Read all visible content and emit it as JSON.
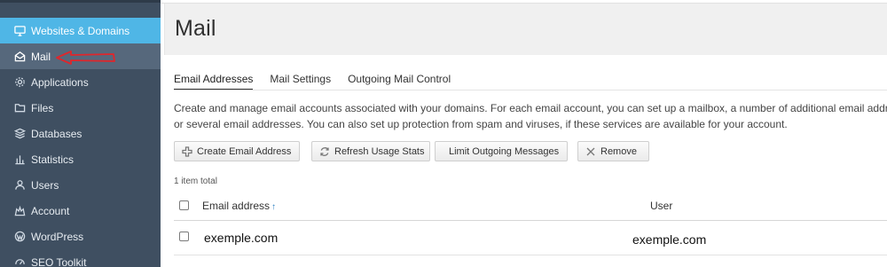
{
  "sidebar": {
    "items": [
      {
        "label": "Websites & Domains",
        "icon": "monitor-icon"
      },
      {
        "label": "Mail",
        "icon": "envelope-icon"
      },
      {
        "label": "Applications",
        "icon": "gear-icon"
      },
      {
        "label": "Files",
        "icon": "folder-icon"
      },
      {
        "label": "Databases",
        "icon": "database-icon"
      },
      {
        "label": "Statistics",
        "icon": "bar-chart-icon"
      },
      {
        "label": "Users",
        "icon": "user-icon"
      },
      {
        "label": "Account",
        "icon": "account-icon"
      },
      {
        "label": "WordPress",
        "icon": "wordpress-icon"
      },
      {
        "label": "SEO Toolkit",
        "icon": "seo-icon"
      }
    ],
    "annotation_color": "#e0262b"
  },
  "header": {
    "title": "Mail"
  },
  "tabs": [
    {
      "label": "Email Addresses",
      "active": true
    },
    {
      "label": "Mail Settings",
      "active": false
    },
    {
      "label": "Outgoing Mail Control",
      "active": false
    }
  ],
  "description": {
    "line1": "Create and manage email accounts associated with your domains. For each email account, you can set up a mailbox, a number of additional email addres",
    "line2": "or several email addresses. You can also set up protection from spam and viruses, if these services are available for your account."
  },
  "toolbar": {
    "create_label": "Create Email Address",
    "refresh_label": "Refresh Usage Stats",
    "limit_label": "Limit Outgoing Messages",
    "remove_label": "Remove"
  },
  "list": {
    "total": "1 item total",
    "columns": {
      "email": "Email address",
      "sort": "↑",
      "user": "User"
    },
    "rows": [
      {
        "email": "exemple.com",
        "user": "exemple.com"
      }
    ]
  },
  "colors": {
    "sidebar_bg": "#3f4f61",
    "sidebar_active": "#4fb6e6",
    "sort_arrow": "#2a7fc0"
  }
}
